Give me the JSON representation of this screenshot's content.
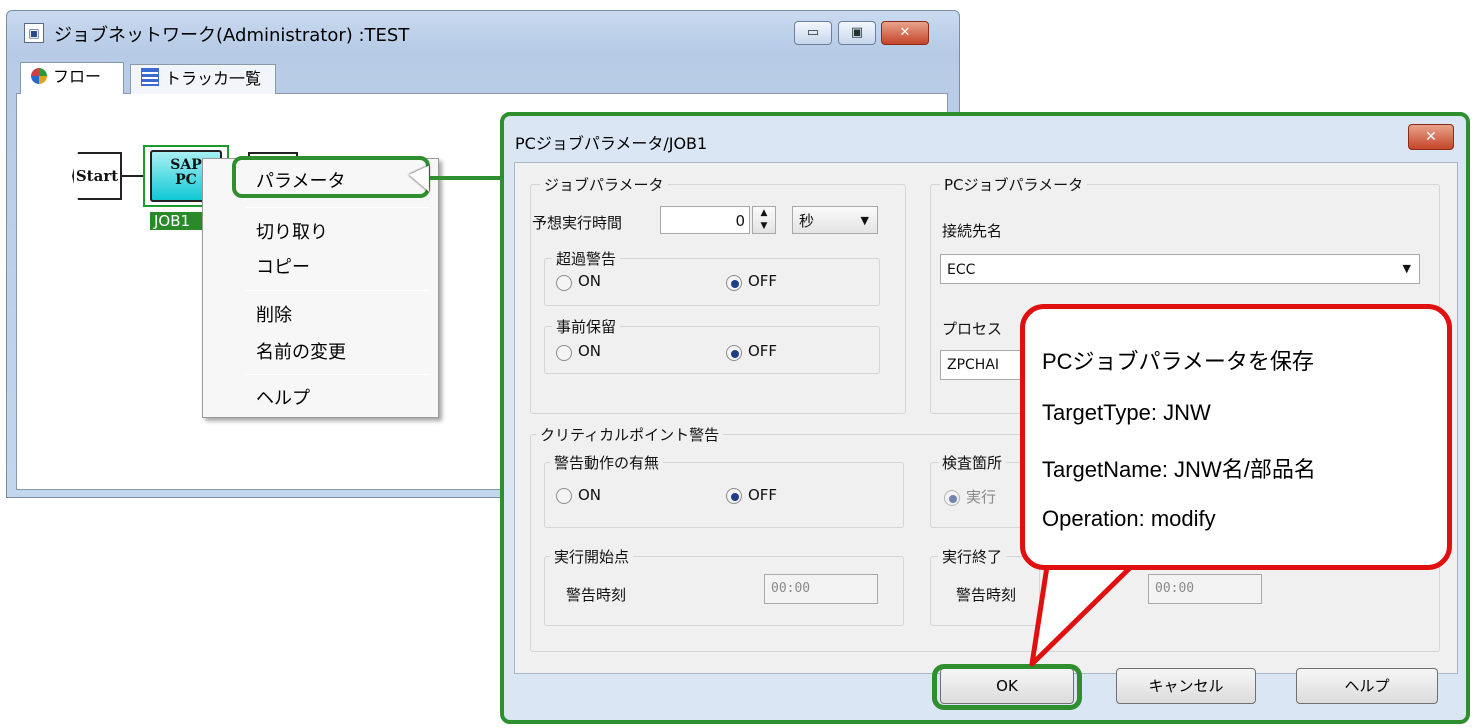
{
  "bg_window": {
    "title": "ジョブネットワーク(Administrator) :TEST",
    "icon": "window-app-icon",
    "caption_buttons": {
      "minimize": "▭",
      "maximize": "▣",
      "close": "✕"
    },
    "tabs": [
      {
        "label": "フロー",
        "icon": "flow-icon"
      },
      {
        "label": "トラッカ一覧",
        "icon": "tracker-list-icon"
      }
    ]
  },
  "flow": {
    "start_node": "Start",
    "sap_node_text": "SAP\nPC",
    "sap_node_label": "JOB1"
  },
  "context_menu": {
    "items": [
      "パラメータ",
      "切り取り",
      "コピー",
      "削除",
      "名前の変更",
      "ヘルプ"
    ]
  },
  "dialog": {
    "title": "PCジョブパラメータ/JOB1",
    "close": "✕",
    "job_params": {
      "group_label": "ジョブパラメータ",
      "expected_time_label": "予想実行時間",
      "expected_time_value": "0",
      "unit_value": "秒",
      "overtime_label": "超過警告",
      "overtime_on": "ON",
      "overtime_off": "OFF",
      "overtime_selected": "OFF",
      "hold_label": "事前保留",
      "hold_on": "ON",
      "hold_off": "OFF",
      "hold_selected": "OFF"
    },
    "pc_params": {
      "group_label": "PCジョブパラメータ",
      "dest_label": "接続先名",
      "dest_value": "ECC",
      "process_label": "プロセス",
      "process_value": "ZPCHAI"
    },
    "critical": {
      "group_label": "クリティカルポイント警告",
      "action_label": "警告動作の有無",
      "action_on": "ON",
      "action_off": "OFF",
      "action_selected": "OFF",
      "check_label": "検査箇所",
      "check_option": "実行",
      "start_label": "実行開始点",
      "start_time_label": "警告時刻",
      "start_time_value": "00:00",
      "end_label": "実行終了",
      "end_time_label": "警告時刻",
      "end_time_value": "00:00"
    },
    "buttons": {
      "ok": "OK",
      "cancel": "キャンセル",
      "help": "ヘルプ"
    }
  },
  "callout": {
    "line1": "PCジョブパラメータを保存",
    "line2": "TargetType: JNW",
    "line3": "TargetName: JNW名/部品名",
    "line4": "Operation: modify"
  },
  "colors": {
    "highlight_green": "#2f8f2f",
    "callout_red": "#e11010",
    "node_cyan": "#10c9d6"
  }
}
